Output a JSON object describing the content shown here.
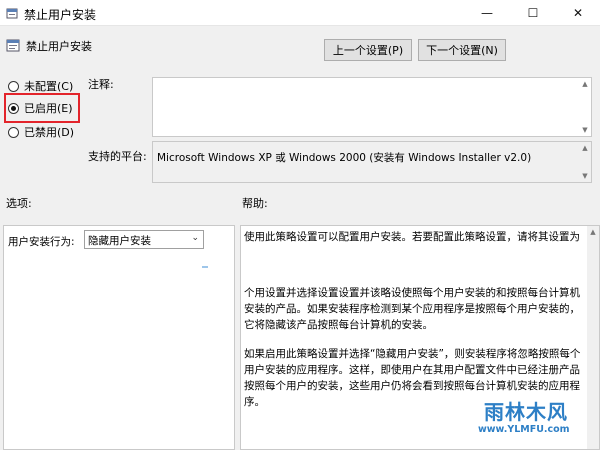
{
  "window": {
    "title": "禁止用户安装",
    "min_glyph": "—",
    "max_glyph": "☐",
    "close_glyph": "✕"
  },
  "header": {
    "policy_name": "禁止用户安装",
    "prev_button": "上一个设置(P)",
    "next_button": "下一个设置(N)"
  },
  "state": {
    "options": [
      {
        "label": "未配置(C)",
        "checked": false
      },
      {
        "label": "已启用(E)",
        "checked": true
      },
      {
        "label": "已禁用(D)",
        "checked": false
      }
    ],
    "highlight_color": "#e3242b"
  },
  "comment": {
    "label": "注释:",
    "value": ""
  },
  "platform": {
    "label": "支持的平台:",
    "value": "Microsoft Windows XP 或 Windows 2000 (安装有 Windows Installer v2.0)"
  },
  "sections": {
    "options_label": "选项:",
    "help_label": "帮助:"
  },
  "options": {
    "install_label": "用户安装行为:",
    "install_value": "隐藏用户安装"
  },
  "help": {
    "p1": "使用此策略设置可以配置用户安装。若要配置此策略设置，请将其设置为",
    "p2": "个用设置并选择设置设置并该略设使照每个用户安装的和按照每台计算机安装的产品。如果安装程序检测到某个应用程序是按照每个用户安装的，它将隐藏该产品按照每台计算机的安装。",
    "p3": "如果启用此策略设置并选择“隐藏用户安装”，则安装程序将忽略按照每个用户安装的应用程序。这样，即使用户在其用户配置文件中已经注册产品按照每个用户的安装，这些用户仍将会看到按照每台计算机安装的应用程序。"
  },
  "watermark": {
    "text": "雨林木风",
    "url": "www.YLMFU.com"
  }
}
